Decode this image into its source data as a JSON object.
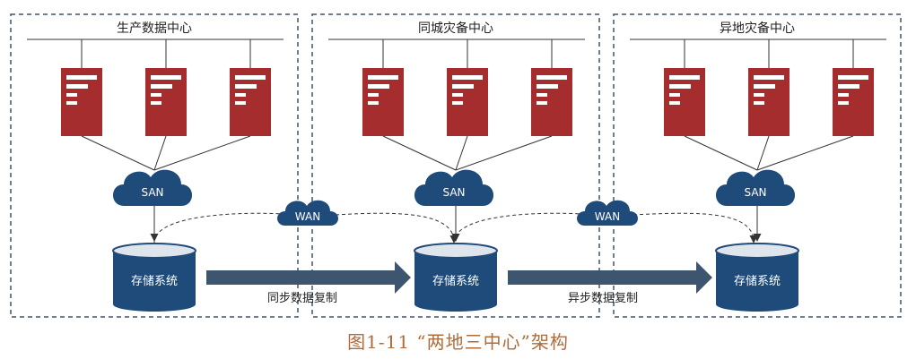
{
  "colors": {
    "server": "#a52d2d",
    "cloud": "#1e4b7a",
    "storage": "#1e4b7a",
    "arrow": "#3e5570",
    "box_border": "#3e5570",
    "line": "#333333",
    "caption": "#b06b3a"
  },
  "diagram": {
    "datacenters": [
      {
        "name": "生产数据中心",
        "san_label": "SAN",
        "storage_label": "存储系统"
      },
      {
        "name": "同城灾备中心",
        "san_label": "SAN",
        "storage_label": "存储系统"
      },
      {
        "name": "异地灾备中心",
        "san_label": "SAN",
        "storage_label": "存储系统"
      }
    ],
    "wan_links": [
      {
        "label": "WAN"
      },
      {
        "label": "WAN"
      }
    ],
    "replications": [
      {
        "label": "同步数据复制"
      },
      {
        "label": "异步数据复制"
      }
    ],
    "caption": "图1-11 “两地三中心”架构"
  }
}
